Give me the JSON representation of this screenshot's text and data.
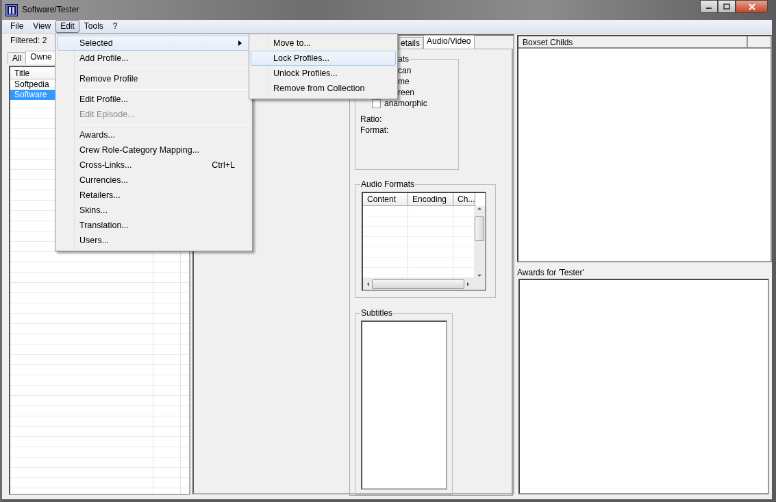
{
  "window": {
    "title": "Software/Tester"
  },
  "menu_bar": [
    {
      "label": "File",
      "selected": false
    },
    {
      "label": "View",
      "selected": false
    },
    {
      "label": "Edit",
      "selected": true
    },
    {
      "label": "Tools",
      "selected": false
    },
    {
      "label": "?",
      "selected": false
    }
  ],
  "edit_menu": [
    {
      "kind": "item",
      "label": "Selected",
      "submenu": true,
      "selected": true,
      "disabled": false
    },
    {
      "kind": "item",
      "label": "Add Profile...",
      "submenu": false,
      "selected": false,
      "disabled": false
    },
    {
      "kind": "separator"
    },
    {
      "kind": "item",
      "label": "Remove Profile",
      "submenu": false,
      "selected": false,
      "disabled": false
    },
    {
      "kind": "separator"
    },
    {
      "kind": "item",
      "label": "Edit Profile...",
      "submenu": false,
      "selected": false,
      "disabled": false
    },
    {
      "kind": "item",
      "label": "Edit Episode...",
      "submenu": false,
      "selected": false,
      "disabled": true
    },
    {
      "kind": "separator"
    },
    {
      "kind": "item",
      "label": "Awards...",
      "submenu": false,
      "selected": false,
      "disabled": false
    },
    {
      "kind": "item",
      "label": "Crew Role-Category Mapping...",
      "submenu": false,
      "selected": false,
      "disabled": false
    },
    {
      "kind": "item",
      "label": "Cross-Links...",
      "shortcut": "Ctrl+L",
      "submenu": false,
      "selected": false,
      "disabled": false
    },
    {
      "kind": "item",
      "label": "Currencies...",
      "submenu": false,
      "selected": false,
      "disabled": false
    },
    {
      "kind": "item",
      "label": "Retailers...",
      "submenu": false,
      "selected": false,
      "disabled": false
    },
    {
      "kind": "item",
      "label": "Skins...",
      "submenu": false,
      "selected": false,
      "disabled": false
    },
    {
      "kind": "item",
      "label": "Translation...",
      "submenu": false,
      "selected": false,
      "disabled": false
    },
    {
      "kind": "item",
      "label": "Users...",
      "submenu": false,
      "selected": false,
      "disabled": false
    }
  ],
  "selected_submenu": [
    {
      "label": "Move to...",
      "selected": false
    },
    {
      "label": "Lock Profiles...",
      "selected": true
    },
    {
      "label": "Unlock Profiles...",
      "selected": false
    },
    {
      "label": "Remove from Collection",
      "selected": false
    }
  ],
  "filter_status": "Filtered: 2",
  "list_tabs": [
    {
      "label": "All",
      "selected": false
    },
    {
      "label": "Owne",
      "selected": true
    }
  ],
  "profile_list": {
    "columns": [
      "Title"
    ],
    "rows": [
      {
        "title": "Softpedia",
        "selected": false
      },
      {
        "title": "Software",
        "selected": true
      }
    ]
  },
  "detail_tabs": [
    {
      "label": "etails",
      "selected": false
    },
    {
      "label": "Audio/Video",
      "selected": true
    }
  ],
  "video_formats": {
    "title": "ats",
    "options": [
      {
        "kind": "partial",
        "label": "can"
      },
      {
        "kind": "partial",
        "label": "me"
      },
      {
        "kind": "partial",
        "label": "reen"
      },
      {
        "kind": "checkbox",
        "label": "anamorphic",
        "checked": false
      }
    ],
    "ratio_label": "Ratio:",
    "format_label": "Format:"
  },
  "audio_formats": {
    "title": "Audio Formats",
    "columns": [
      "Content",
      "Encoding",
      "Ch..."
    ]
  },
  "subtitles": {
    "title": "Subtitles"
  },
  "boxset_list": {
    "columns": [
      "Boxset Childs"
    ]
  },
  "awards": {
    "label": "Awards for 'Tester'"
  }
}
